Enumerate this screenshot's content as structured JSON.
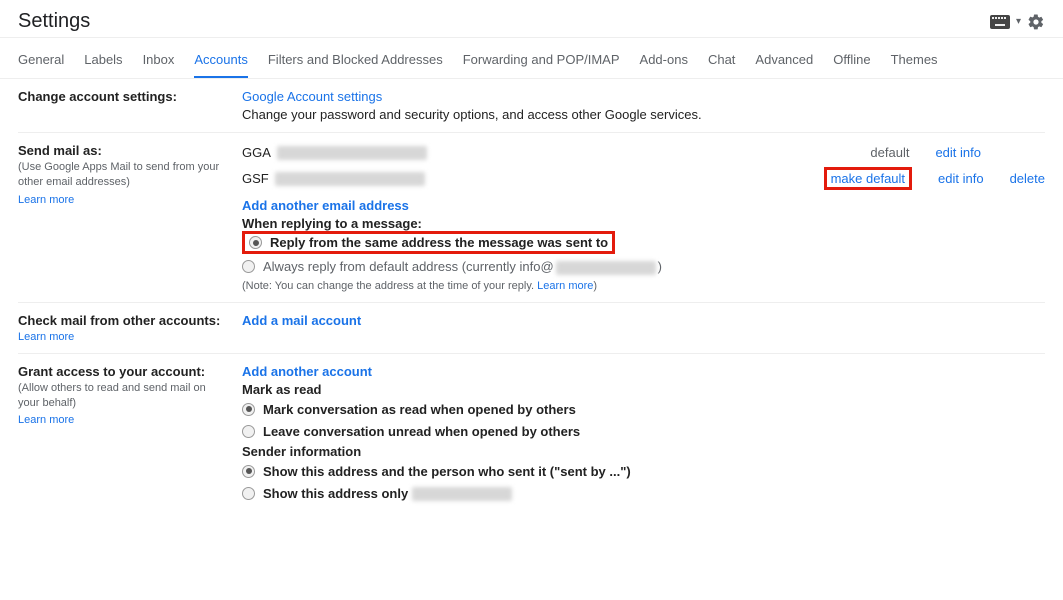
{
  "header": {
    "title": "Settings"
  },
  "tabs": {
    "items": [
      {
        "label": "General"
      },
      {
        "label": "Labels"
      },
      {
        "label": "Inbox"
      },
      {
        "label": "Accounts"
      },
      {
        "label": "Filters and Blocked Addresses"
      },
      {
        "label": "Forwarding and POP/IMAP"
      },
      {
        "label": "Add-ons"
      },
      {
        "label": "Chat"
      },
      {
        "label": "Advanced"
      },
      {
        "label": "Offline"
      },
      {
        "label": "Themes"
      }
    ],
    "active_index": 3
  },
  "change_account": {
    "label": "Change account settings:",
    "link": "Google Account settings",
    "desc": "Change your password and security options, and access other Google services."
  },
  "send_mail_as": {
    "label": "Send mail as:",
    "hint": "(Use Google Apps Mail to send from your other email addresses)",
    "learn_more": "Learn more",
    "rows": [
      {
        "name": "GGA",
        "status": "default",
        "edit": "edit info",
        "delete": null,
        "make_default": null
      },
      {
        "name": "GSF",
        "status": null,
        "edit": "edit info",
        "delete": "delete",
        "make_default": "make default"
      }
    ],
    "add_link": "Add another email address",
    "reply_heading": "When replying to a message:",
    "reply_opts": [
      {
        "label": "Reply from the same address the message was sent to",
        "selected": true
      },
      {
        "label": "Always reply from default address (currently info@",
        "selected": false,
        "suffix": ")"
      }
    ],
    "note_prefix": "(Note: You can change the address at the time of your reply. ",
    "note_link": "Learn more",
    "note_suffix": ")"
  },
  "check_mail": {
    "label": "Check mail from other accounts:",
    "learn_more": "Learn more",
    "link": "Add a mail account"
  },
  "grant_access": {
    "label": "Grant access to your account:",
    "hint": "(Allow others to read and send mail on your behalf)",
    "learn_more": "Learn more",
    "add_link": "Add another account",
    "mark_heading": "Mark as read",
    "mark_opts": [
      {
        "label": "Mark conversation as read when opened by others",
        "selected": true
      },
      {
        "label": "Leave conversation unread when opened by others",
        "selected": false
      }
    ],
    "sender_heading": "Sender information",
    "sender_opts": [
      {
        "label": "Show this address and the person who sent it (\"sent by ...\")",
        "selected": true
      },
      {
        "label": "Show this address only ",
        "selected": false,
        "has_blur": true
      }
    ]
  }
}
